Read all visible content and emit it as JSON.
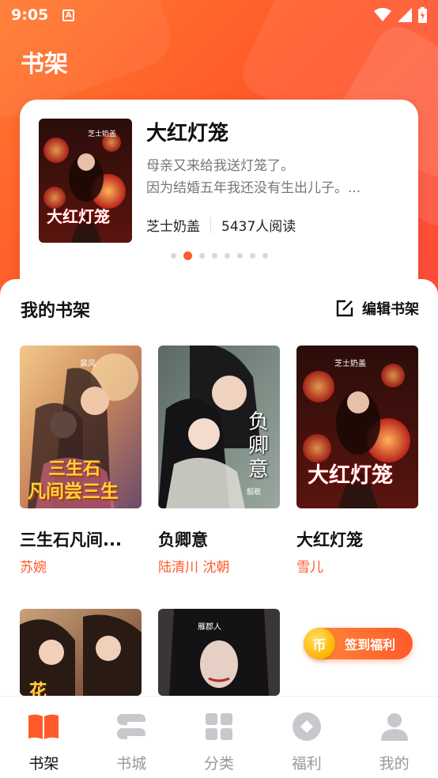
{
  "status_bar": {
    "time": "9:05",
    "notification_icon": "A"
  },
  "page_title": "书架",
  "featured": {
    "title": "大红灯笼",
    "desc_line1": "母亲又来给我送灯笼了。",
    "desc_line2": "因为结婚五年我还没有生出儿子。...",
    "author": "芝士奶盖",
    "reads": "5437人阅读",
    "cover": {
      "author_tag": "芝士奶盖",
      "cover_title": "大红灯笼"
    },
    "carousel_pages": 8,
    "carousel_active": 1
  },
  "shelf": {
    "heading": "我的书架",
    "edit_label": "编辑书架",
    "books": [
      {
        "title": "三生石凡间...",
        "author": "苏婉",
        "cover_title_1": "三生石",
        "cover_title_2": "凡间尝三生",
        "author_tag": "裴风"
      },
      {
        "title": "负卿意",
        "author": "陆清川 沈朝",
        "cover_title_1": "负卿意",
        "author_tag": "韶歌"
      },
      {
        "title": "大红灯笼",
        "author": "雪儿",
        "cover_title_1": "大红灯笼",
        "author_tag": "芝士奶盖"
      },
      {
        "title": "",
        "author": "",
        "cover_title_1": "花",
        "author_tag": ""
      },
      {
        "title": "",
        "author": "",
        "cover_title_1": "",
        "author_tag": "雁郡人"
      }
    ]
  },
  "checkin": {
    "coin": "币",
    "label": "签到福利"
  },
  "tabs": [
    {
      "label": "书架",
      "icon": "book-open-icon",
      "active": true
    },
    {
      "label": "书城",
      "icon": "books-stack-icon",
      "active": false
    },
    {
      "label": "分类",
      "icon": "grid-icon",
      "active": false
    },
    {
      "label": "福利",
      "icon": "diamond-coin-icon",
      "active": false
    },
    {
      "label": "我的",
      "icon": "user-icon",
      "active": false
    }
  ],
  "colors": {
    "accent": "#ff5a2a",
    "inactive_tab": "#999999"
  }
}
